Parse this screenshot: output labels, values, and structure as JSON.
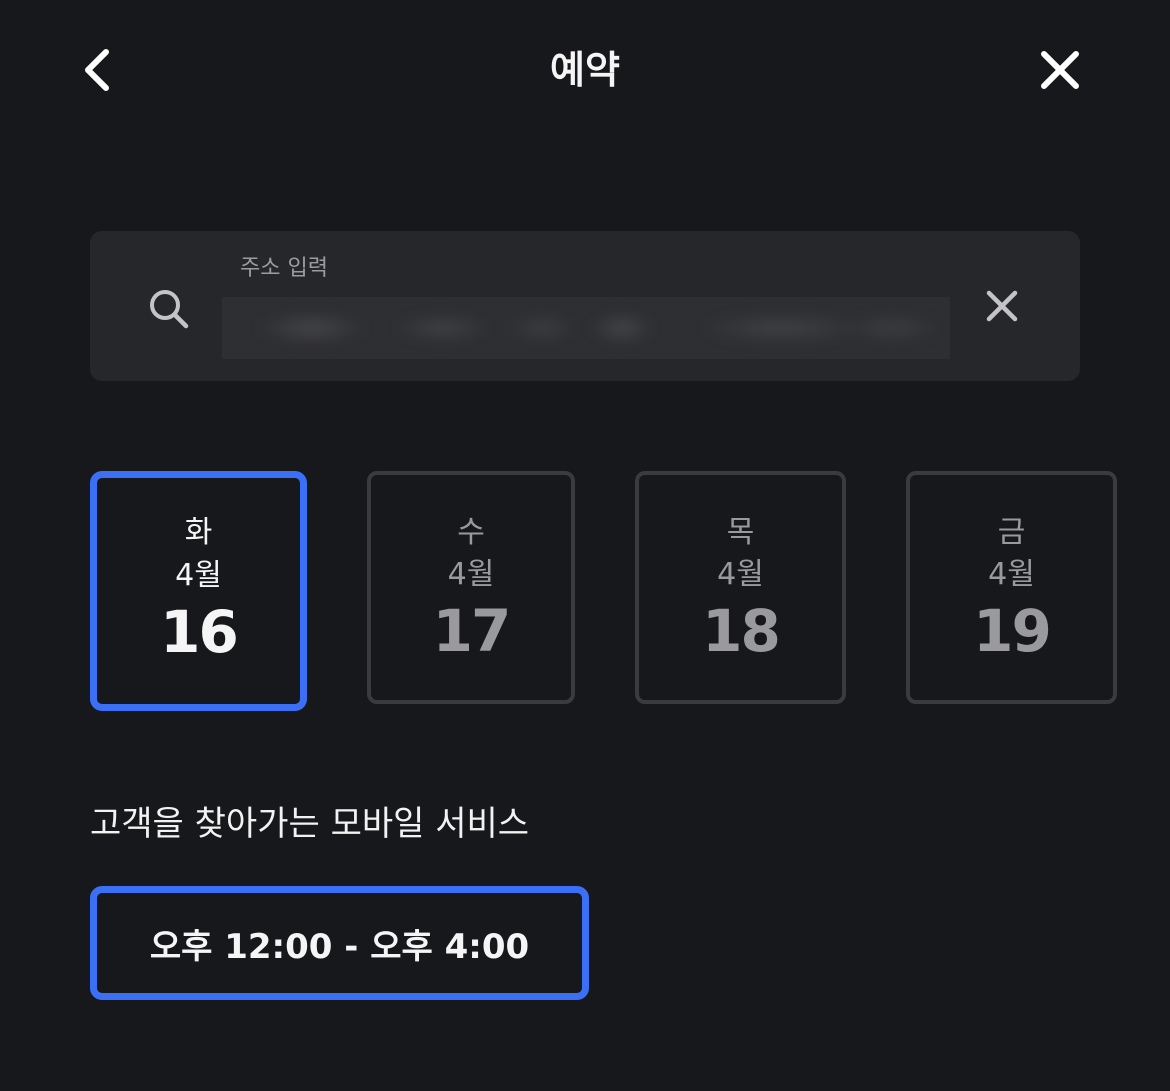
{
  "header": {
    "title": "예약",
    "back_icon": "chevron-left-icon",
    "close_icon": "close-icon"
  },
  "search": {
    "label": "주소 입력",
    "value": "",
    "icon": "search-icon",
    "clear_icon": "clear-icon"
  },
  "dates": [
    {
      "dow": "화",
      "month": "4월",
      "day": "16",
      "selected": true
    },
    {
      "dow": "수",
      "month": "4월",
      "day": "17",
      "selected": false
    },
    {
      "dow": "목",
      "month": "4월",
      "day": "18",
      "selected": false
    },
    {
      "dow": "금",
      "month": "4월",
      "day": "19",
      "selected": false
    }
  ],
  "service": {
    "title": "고객을 찾아가는 모바일 서비스",
    "time_slot": "오후 12:00 - 오후 4:00"
  },
  "colors": {
    "background": "#17181b",
    "accent": "#3b6ff6",
    "card_border": "#3a3b3f",
    "search_bg": "#26272b"
  }
}
